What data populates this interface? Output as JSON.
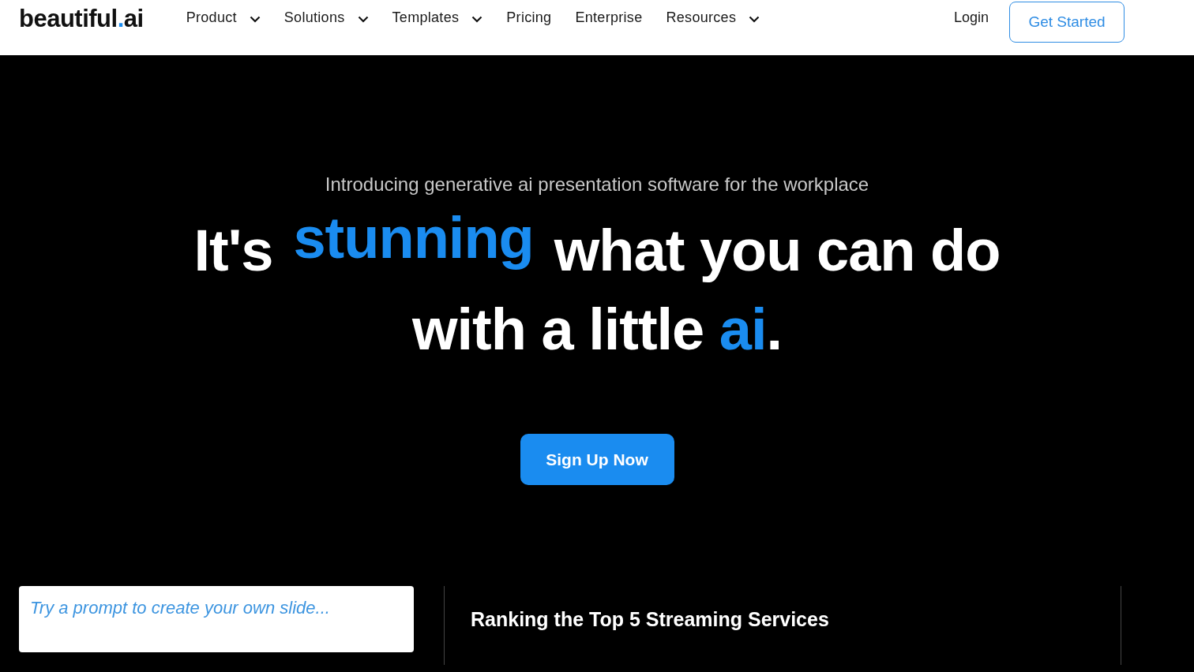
{
  "logo": {
    "parts": [
      {
        "text": "beautiful",
        "highlight": false
      },
      {
        "text": ".",
        "highlight": true
      },
      {
        "text": "ai",
        "highlight": false
      }
    ]
  },
  "nav": [
    {
      "label": "Product",
      "dropdown": true
    },
    {
      "label": "Solutions",
      "dropdown": true
    },
    {
      "label": "Templates",
      "dropdown": true
    },
    {
      "label": "Pricing",
      "dropdown": false
    },
    {
      "label": "Enterprise",
      "dropdown": false
    },
    {
      "label": "Resources",
      "dropdown": true
    }
  ],
  "login": "Login",
  "cta": "Get Started",
  "hero": {
    "tagline": "Introducing generative ai presentation software for the workplace",
    "lines": [
      [
        {
          "text": "It's",
          "highlight": false
        },
        {
          "text": "stunning",
          "highlight": true
        },
        {
          "text": "what you can do",
          "highlight": false
        }
      ],
      [
        {
          "text": "with a little ",
          "highlight": false
        },
        {
          "text": "ai",
          "highlight": true
        },
        {
          "text": ".",
          "highlight": false
        }
      ]
    ],
    "button": "Sign Up Now"
  },
  "prompt": {
    "placeholder": "Try a prompt to create your own slide..."
  },
  "slide_title": "Ranking the Top 5 Streaming Services"
}
